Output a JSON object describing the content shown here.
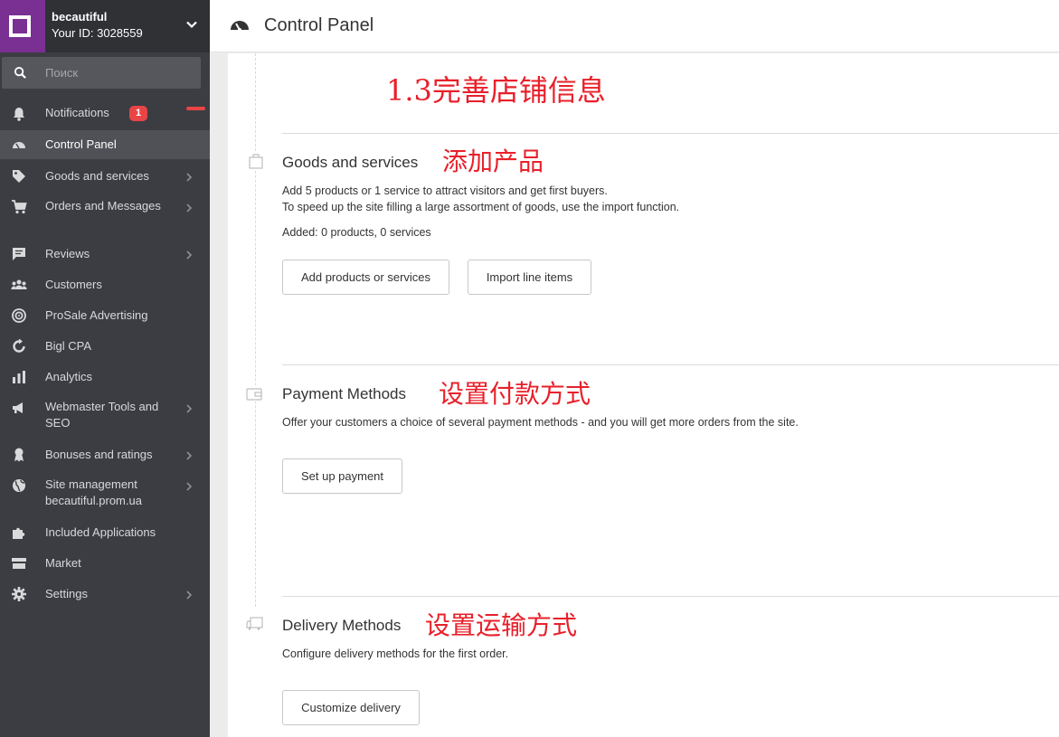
{
  "account": {
    "name": "becautiful",
    "id_label": "Your ID: 3028559"
  },
  "search": {
    "placeholder": "Поиск",
    "value": ""
  },
  "sidebar": {
    "items": [
      {
        "label": "Notifications",
        "icon": "bell-icon",
        "badge": "1"
      },
      {
        "label": "Control Panel",
        "icon": "speedometer-icon",
        "active": true
      },
      {
        "label": "Goods and services",
        "icon": "tag-icon",
        "chevron": true
      },
      {
        "label": "Orders and Messages",
        "icon": "cart-icon",
        "chevron": true
      },
      {
        "label": "Reviews",
        "icon": "chat-icon",
        "chevron": true
      },
      {
        "label": "Customers",
        "icon": "people-icon"
      },
      {
        "label": "ProSale Advertising",
        "icon": "target-icon"
      },
      {
        "label": "Bigl CPA",
        "icon": "refresh-icon"
      },
      {
        "label": "Analytics",
        "icon": "bar-chart-icon"
      },
      {
        "label": "Webmaster Tools and SEO",
        "icon": "megaphone-icon",
        "chevron": true
      },
      {
        "label": "Bonuses and ratings",
        "icon": "medal-icon",
        "chevron": true
      },
      {
        "label": "Site management becautiful.prom.ua",
        "icon": "globe-icon",
        "chevron": true
      },
      {
        "label": "Included Applications",
        "icon": "puzzle-icon"
      },
      {
        "label": "Market",
        "icon": "store-icon"
      },
      {
        "label": "Settings",
        "icon": "gear-icon",
        "chevron": true
      }
    ]
  },
  "header": {
    "title": "Control Panel",
    "icon": "speedometer-icon"
  },
  "main": {
    "top_annotation": "1.3完善店铺信息",
    "sections": [
      {
        "title": "Goods and services",
        "annotation": "添加产品",
        "icon": "shopping-bag-icon",
        "lines": [
          "Add 5 products or 1 service to attract visitors and get first buyers.",
          "To speed up the site filling a large assortment of goods, use the import function."
        ],
        "status": "Added: 0 products, 0 services",
        "buttons": [
          "Add products or services",
          "Import line items"
        ]
      },
      {
        "title": "Payment Methods",
        "annotation": "设置付款方式",
        "icon": "wallet-icon",
        "lines": [
          "Offer your customers a choice of several payment methods - and you will get more orders from the site."
        ],
        "buttons": [
          "Set up payment"
        ]
      },
      {
        "title": "Delivery Methods",
        "annotation": "设置运输方式",
        "icon": "delivery-truck-icon",
        "lines": [
          "Configure delivery methods for the first order."
        ],
        "buttons": [
          "Customize delivery"
        ]
      }
    ]
  },
  "colors": {
    "sidebar_bg": "#3b3d42",
    "account_bg": "#2f3135",
    "logo_bg": "#7a2f93",
    "active_item_bg": "#4f5156",
    "badge_bg": "#e94446",
    "annotation_red": "#e8202a"
  }
}
